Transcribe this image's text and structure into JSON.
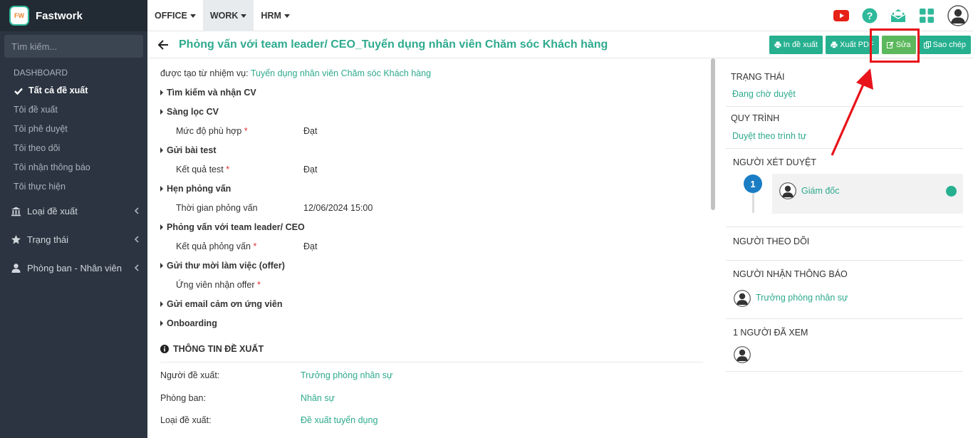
{
  "app": {
    "name": "Fastwork",
    "logo_text": "FW"
  },
  "sidebar": {
    "search_placeholder": "Tìm kiếm...",
    "section": "DASHBOARD",
    "items": [
      {
        "label": "Tất cả đề xuất",
        "active": true
      },
      {
        "label": "Tôi đề xuất"
      },
      {
        "label": "Tôi phê duyệt"
      },
      {
        "label": "Tôi theo dõi"
      },
      {
        "label": "Tôi nhận thông báo"
      },
      {
        "label": "Tôi thực hiện"
      }
    ],
    "groups": [
      {
        "label": "Loại đề xuất",
        "icon": "bank-icon"
      },
      {
        "label": "Trạng thái",
        "icon": "star-icon"
      },
      {
        "label": "Phòng ban - Nhân viên",
        "icon": "user-icon"
      }
    ]
  },
  "topnav": {
    "items": [
      "OFFICE",
      "WORK",
      "HRM"
    ],
    "active": "WORK"
  },
  "title": {
    "text": "Phỏng vấn với team leader/ CEO_Tuyển dụng nhân viên Chăm sóc Khách hàng"
  },
  "actions": {
    "print": "In đề xuất",
    "pdf": "Xuất PDF",
    "edit": "Sửa",
    "copy": "Sao chép"
  },
  "content": {
    "origin_prefix": "được tạo từ nhiệm vụ:",
    "origin_link": "Tuyển dụng nhân viên Chăm sóc Khách hàng",
    "steps": [
      "Tìm kiếm và nhận CV",
      "Sàng lọc CV",
      "Gửi bài test",
      "Hẹn phỏng vấn",
      "Phỏng vấn với team leader/ CEO",
      "Gửi thư mời làm việc (offer)",
      "Gửi email cảm ơn ứng viên",
      "Onboarding"
    ],
    "fields": [
      {
        "label": "Mức độ phù hợp",
        "required": "*",
        "value": "Đạt"
      },
      {
        "label": "Kết quả test",
        "required": "*",
        "value": "Đạt"
      },
      {
        "label": "Thời gian phỏng vấn",
        "required": "",
        "value": "12/06/2024 15:00"
      },
      {
        "label": "Kết quả phỏng vấn",
        "required": "*",
        "value": "Đạt"
      },
      {
        "label": "Ứng viên nhận offer",
        "required": "*",
        "value": ""
      }
    ],
    "info_title": "THÔNG TIN ĐỀ XUẤT",
    "info": [
      {
        "label": "Người đề xuất:",
        "value": "Trưởng phòng nhân sự"
      },
      {
        "label": "Phòng ban:",
        "value": "Nhân sự"
      },
      {
        "label": "Loại đề xuất:",
        "value": "Đề xuất tuyển dụng"
      }
    ]
  },
  "right": {
    "status_title": "TRẠNG THÁI",
    "status_value": "Đang chờ duyệt",
    "process_title": "QUY TRÌNH",
    "process_value": "Duyệt theo trình tự",
    "approvers_title": "NGƯỜI XÉT DUYỆT",
    "approver_step": "1",
    "approver_name": "Giám đốc",
    "followers_title": "NGƯỜI THEO DÕI",
    "notify_title": "NGƯỜI NHẬN THÔNG BÁO",
    "notify_name": "Trưởng phòng nhân sự",
    "viewed_title": "1 NGƯỜI ĐÃ XEM"
  },
  "colors": {
    "accent": "#2eaa8e",
    "button": "#26b08f",
    "edit": "#5cb85c",
    "highlight": "#e8131b",
    "sidebar": "#2b3440"
  }
}
